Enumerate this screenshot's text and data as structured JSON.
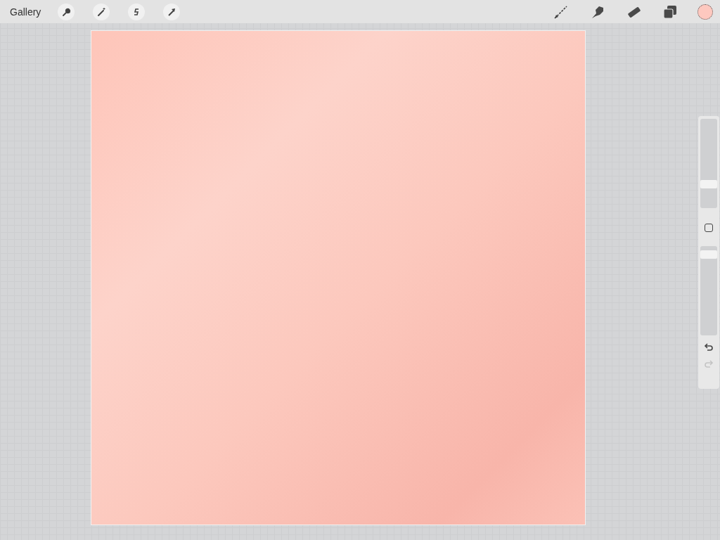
{
  "toolbar": {
    "gallery": "Gallery"
  },
  "color_swatch": {
    "color": "#fdc8bf"
  },
  "sidebar": {
    "brush_size": {
      "level": 0.24
    },
    "opacity": {
      "level": 0.95
    },
    "undo": {
      "disabled": false
    },
    "redo": {
      "disabled": true
    }
  }
}
